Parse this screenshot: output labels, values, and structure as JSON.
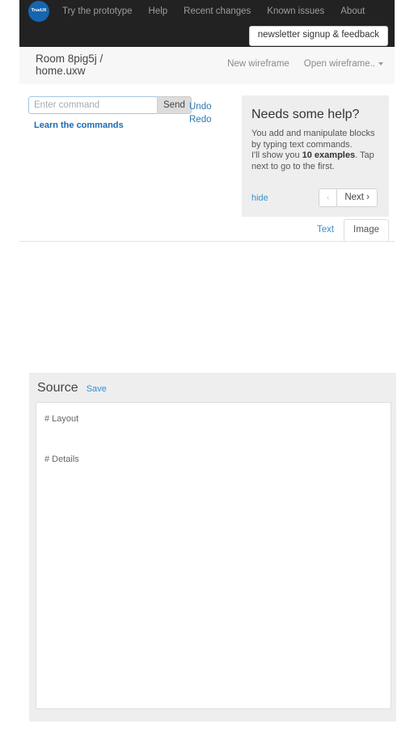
{
  "navbar": {
    "brand": {
      "label": "TrueUX",
      "icon": "brand-logo-icon",
      "color": "#1565b0"
    },
    "links": [
      {
        "label": "Try the prototype"
      },
      {
        "label": "Help"
      },
      {
        "label": "Recent changes"
      },
      {
        "label": "Known issues"
      },
      {
        "label": "About"
      }
    ],
    "newsletter_button": "newsletter signup & feedback",
    "background": "#222222"
  },
  "room_header": {
    "title_line1": "Room 8pig5j /",
    "title_line2": "home.uxw",
    "actions": [
      {
        "label": "New wireframe",
        "has_caret": false
      },
      {
        "label": "Open wireframe..",
        "has_caret": true,
        "icon": "chevron-down-icon"
      }
    ]
  },
  "command_bar": {
    "input_placeholder": "Enter command",
    "input_value": "",
    "send_label": "Send",
    "learn_link": "Learn the commands",
    "undo_label": "Undo",
    "redo_label": "Redo"
  },
  "help_panel": {
    "title": "Needs some help?",
    "body_part1": "You add and manipulate blocks by typing text commands.",
    "body_part2_prefix": "I'll show you ",
    "body_part2_bold": "10 examples",
    "body_part2_suffix": ". Tap next to go to the first.",
    "hide_label": "hide",
    "prev_label": "‹",
    "next_label": "Next ›",
    "background": "#eeeeee"
  },
  "view_tabs": {
    "items": [
      {
        "label": "Text",
        "active": false
      },
      {
        "label": "Image",
        "active": true
      }
    ]
  },
  "source_panel": {
    "title": "Source",
    "save_label": "Save",
    "content": "# Layout\n\n# Details",
    "background": "#eeeeee"
  },
  "colors": {
    "link": "#3a8fcc",
    "nav_bg": "#222222",
    "panel_bg": "#eeeeee",
    "brand": "#1565b0"
  }
}
